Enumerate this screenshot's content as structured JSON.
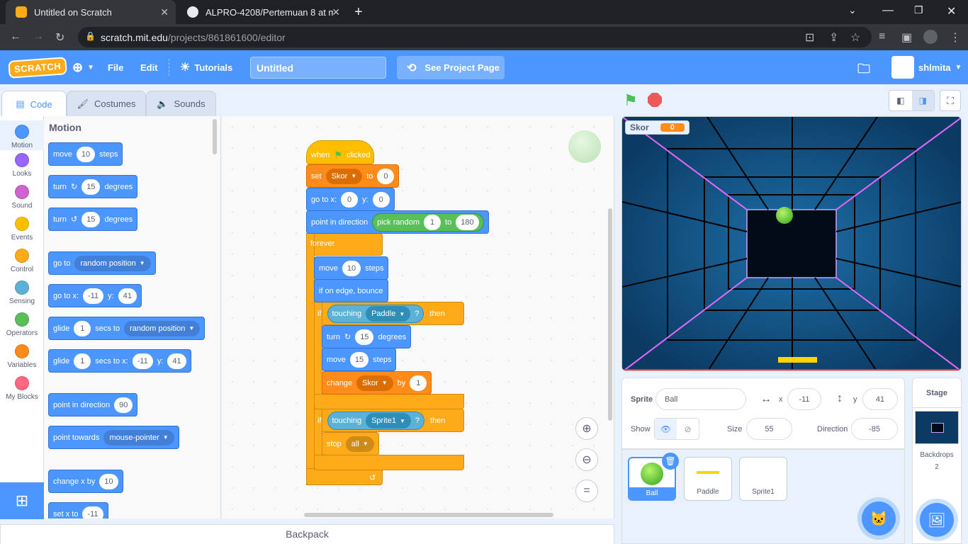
{
  "browser": {
    "tabs": [
      {
        "title": "Untitled on Scratch"
      },
      {
        "title": "ALPRO-4208/Pertemuan 8 at ma"
      }
    ],
    "url_host": "scratch.mit.edu",
    "url_path": "/projects/861861600/editor"
  },
  "menu": {
    "logo": "SCRATCH",
    "file": "File",
    "edit": "Edit",
    "tutorials": "Tutorials",
    "project_title": "Untitled",
    "see_project": "See Project Page",
    "username": "shlmita"
  },
  "editor_tabs": {
    "code": "Code",
    "costumes": "Costumes",
    "sounds": "Sounds"
  },
  "categories": [
    {
      "label": "Motion",
      "color": "#4c97ff"
    },
    {
      "label": "Looks",
      "color": "#9966ff"
    },
    {
      "label": "Sound",
      "color": "#cf63cf"
    },
    {
      "label": "Events",
      "color": "#ffbf00"
    },
    {
      "label": "Control",
      "color": "#ffab19"
    },
    {
      "label": "Sensing",
      "color": "#5cb1d6"
    },
    {
      "label": "Operators",
      "color": "#59c059"
    },
    {
      "label": "Variables",
      "color": "#ff8c1a"
    },
    {
      "label": "My Blocks",
      "color": "#ff6680"
    }
  ],
  "palette": {
    "title": "Motion",
    "move": {
      "a": "move",
      "n": "10",
      "b": "steps"
    },
    "turn_cw": {
      "a": "turn",
      "n": "15",
      "b": "degrees"
    },
    "turn_ccw": {
      "a": "turn",
      "n": "15",
      "b": "degrees"
    },
    "goto": {
      "a": "go to",
      "d": "random position"
    },
    "gotoxy": {
      "a": "go to x:",
      "x": "-11",
      "b": "y:",
      "y": "41"
    },
    "glide": {
      "a": "glide",
      "n": "1",
      "b": "secs to",
      "d": "random position"
    },
    "glidexy": {
      "a": "glide",
      "n": "1",
      "b": "secs to x:",
      "x": "-11",
      "c": "y:",
      "y": "41"
    },
    "point_dir": {
      "a": "point in direction",
      "n": "90"
    },
    "point_towards": {
      "a": "point towards",
      "d": "mouse-pointer"
    },
    "change_x": {
      "a": "change x by",
      "n": "10"
    },
    "set_x": {
      "a": "set x to",
      "n": "-11"
    }
  },
  "script": {
    "hat": {
      "a": "when",
      "b": "clicked"
    },
    "set": {
      "a": "set",
      "var": "Skor",
      "b": "to",
      "n": "0"
    },
    "gotoxy": {
      "a": "go to x:",
      "x": "0",
      "b": "y:",
      "y": "0"
    },
    "point": {
      "a": "point in direction",
      "r": "pick random",
      "n1": "1",
      "to": "to",
      "n2": "180"
    },
    "forever": "forever",
    "move": {
      "a": "move",
      "n": "10",
      "b": "steps"
    },
    "bounce": "if on edge, bounce",
    "if1": {
      "a": "if",
      "sense": "touching",
      "obj": "Paddle",
      "q": "?",
      "then": "then"
    },
    "turn": {
      "a": "turn",
      "n": "15",
      "b": "degrees"
    },
    "move2": {
      "a": "move",
      "n": "15",
      "b": "steps"
    },
    "change": {
      "a": "change",
      "var": "Skor",
      "b": "by",
      "n": "1"
    },
    "if2": {
      "a": "if",
      "sense": "touching",
      "obj": "Sprite1",
      "q": "?",
      "then": "then"
    },
    "stop": {
      "a": "stop",
      "d": "all"
    }
  },
  "backpack": "Backpack",
  "stage": {
    "monitor_label": "Skor",
    "monitor_value": "0"
  },
  "sprite_info": {
    "sprite_label": "Sprite",
    "sprite_name": "Ball",
    "x_label": "x",
    "x": "-11",
    "y_label": "y",
    "y": "41",
    "show_label": "Show",
    "size_label": "Size",
    "size": "55",
    "direction_label": "Direction",
    "direction": "-85"
  },
  "sprites": [
    {
      "name": "Ball"
    },
    {
      "name": "Paddle"
    },
    {
      "name": "Sprite1"
    }
  ],
  "stage_pane": {
    "title": "Stage",
    "backdrops_label": "Backdrops",
    "backdrops_count": "2"
  }
}
